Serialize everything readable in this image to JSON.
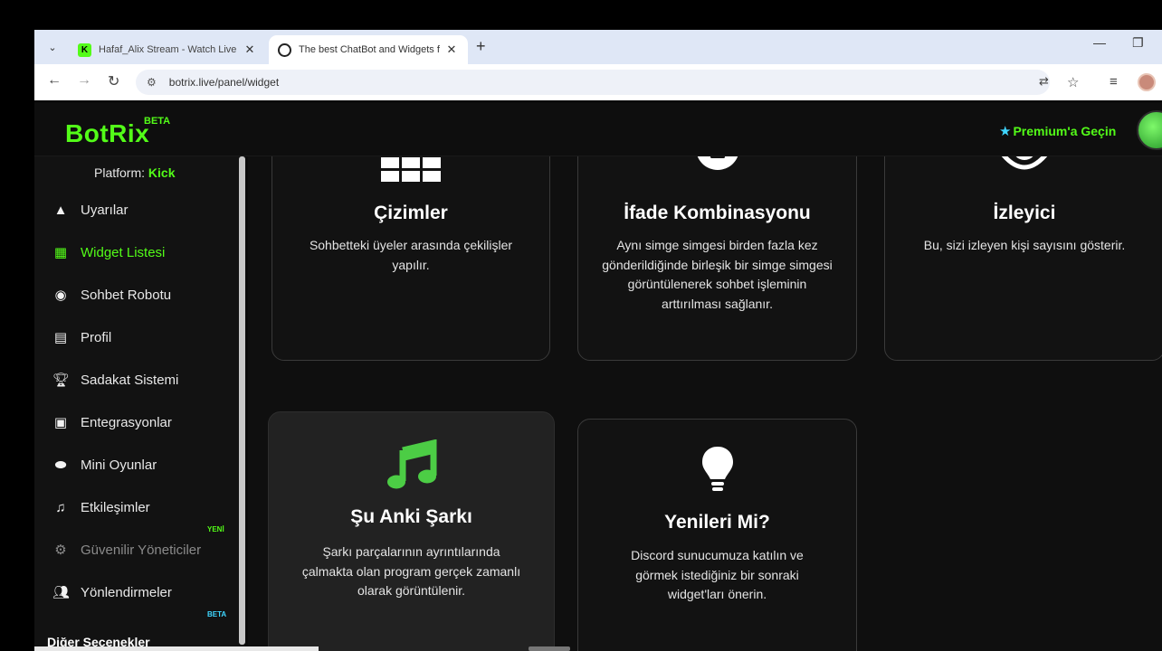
{
  "browser": {
    "tabs": [
      {
        "title": "Hafaf_Alix Stream - Watch Live",
        "favicon": "kick-icon"
      },
      {
        "title": "The best ChatBot and Widgets f",
        "favicon": "botrix-icon",
        "active": true
      }
    ],
    "url": "botrix.live/panel/widget"
  },
  "header": {
    "logo": "BotRix",
    "beta": "BETA",
    "premium": "Premium'a Geçin",
    "accent": "#53fc18"
  },
  "sidebar": {
    "platform_label": "Platform:",
    "platform_value": "Kick",
    "items": [
      {
        "label": "Uyarılar",
        "icon": "warning-icon"
      },
      {
        "label": "Widget Listesi",
        "icon": "grid-icon",
        "active": true
      },
      {
        "label": "Sohbet Robotu",
        "icon": "robot-icon"
      },
      {
        "label": "Profil",
        "icon": "id-card-icon"
      },
      {
        "label": "Sadakat Sistemi",
        "icon": "trophy-icon"
      },
      {
        "label": "Entegrasyonlar",
        "icon": "integration-icon"
      },
      {
        "label": "Mini Oyunlar",
        "icon": "gamepad-icon"
      },
      {
        "label": "Etkileşimler",
        "icon": "music-icon",
        "badge": "YENİ"
      },
      {
        "label": "Güvenilir Yöneticiler",
        "icon": "users-cog-icon",
        "dim": true
      },
      {
        "label": "Yönlendirmeler",
        "icon": "users-icon",
        "badge": "BETA"
      }
    ],
    "other_options": "Diğer Seçenekler"
  },
  "widgets": [
    {
      "title": "Çizimler",
      "desc": "Sohbetteki üyeler arasında çekilişler yapılır.",
      "icon": "grid-icon"
    },
    {
      "title": "İfade Kombinasyonu",
      "desc": "Aynı simge simgesi birden fazla kez gönderildiğinde birleşik bir simge simgesi görüntülenerek sohbet işleminin arttırılması sağlanır.",
      "icon": "face-icon"
    },
    {
      "title": "İzleyici",
      "desc": "Bu, sizi izleyen kişi sayısını gösterir.",
      "icon": "eye-icon"
    },
    {
      "title": "Şu Anki Şarkı",
      "desc": "Şarkı parçalarının ayrıntılarında çalmakta olan program gerçek zamanlı olarak görüntülenir.",
      "icon": "music-icon"
    },
    {
      "title": "Yenileri Mi?",
      "desc": "Discord sunucumuza katılın ve görmek istediğiniz bir sonraki widget'ları önerin.",
      "icon": "lightbulb-icon"
    }
  ]
}
